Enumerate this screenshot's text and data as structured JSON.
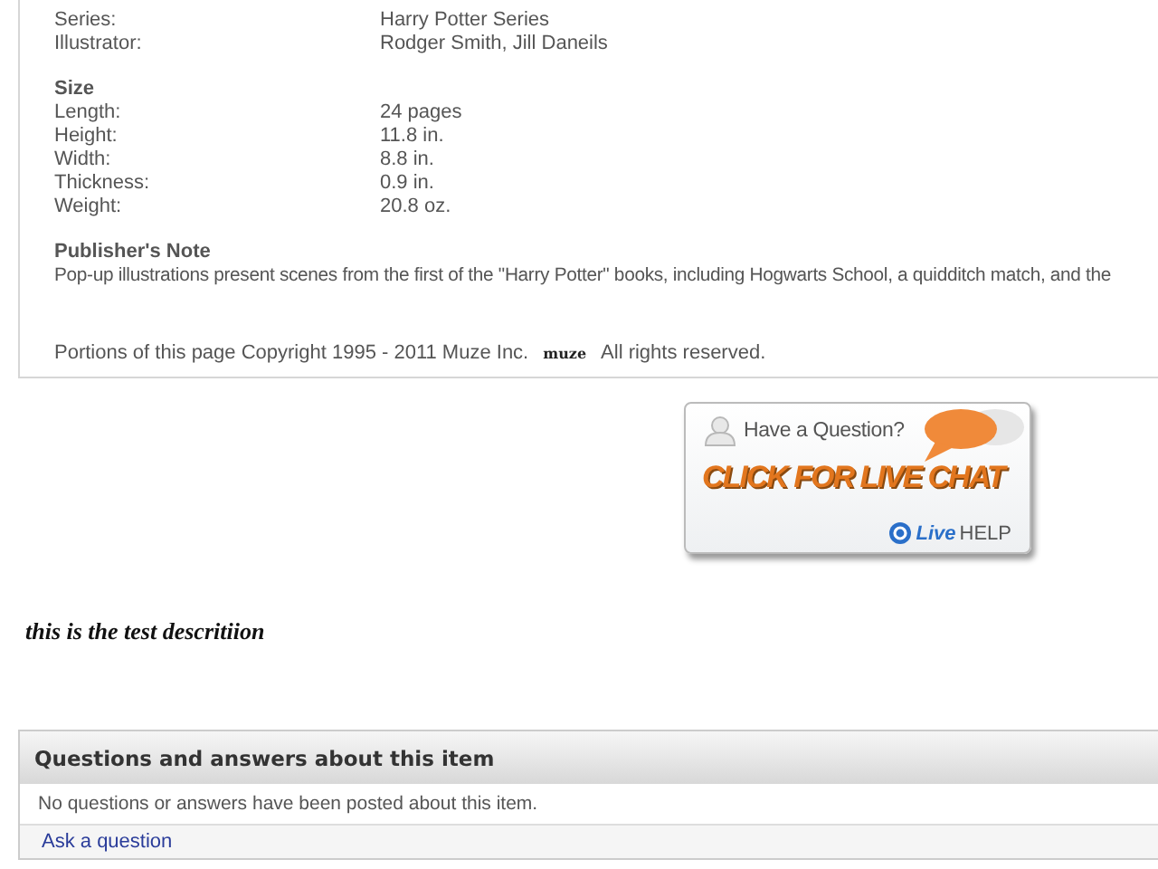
{
  "details": {
    "rows": [
      {
        "label": "Series:",
        "value": "Harry Potter Series"
      },
      {
        "label": "Illustrator:",
        "value": "Rodger Smith, Jill Daneils"
      }
    ]
  },
  "size": {
    "heading": "Size",
    "rows": [
      {
        "label": "Length:",
        "value": "24 pages"
      },
      {
        "label": "Height:",
        "value": "11.8 in."
      },
      {
        "label": "Width:",
        "value": "8.8 in."
      },
      {
        "label": "Thickness:",
        "value": "0.9 in."
      },
      {
        "label": "Weight:",
        "value": "20.8 oz."
      }
    ]
  },
  "publishers_note": {
    "heading": "Publisher's Note",
    "text": "Pop-up illustrations present scenes from the first of the \"Harry Potter\" books, including Hogwarts School, a quidditch match, and the"
  },
  "copyright": {
    "text": "Portions of this page Copyright 1995 - 2011 Muze Inc.",
    "logo": "muze",
    "rights": "All rights reserved."
  },
  "live_chat": {
    "question": "Have a Question?",
    "call": "CLICK FOR LIVE CHAT",
    "brand_a": "Live",
    "brand_b": "HELP"
  },
  "description": "this is the test descritiion",
  "qa": {
    "title": "Questions and answers about this item",
    "message": "No questions or answers have been posted about this item.",
    "link": "Ask a question"
  }
}
